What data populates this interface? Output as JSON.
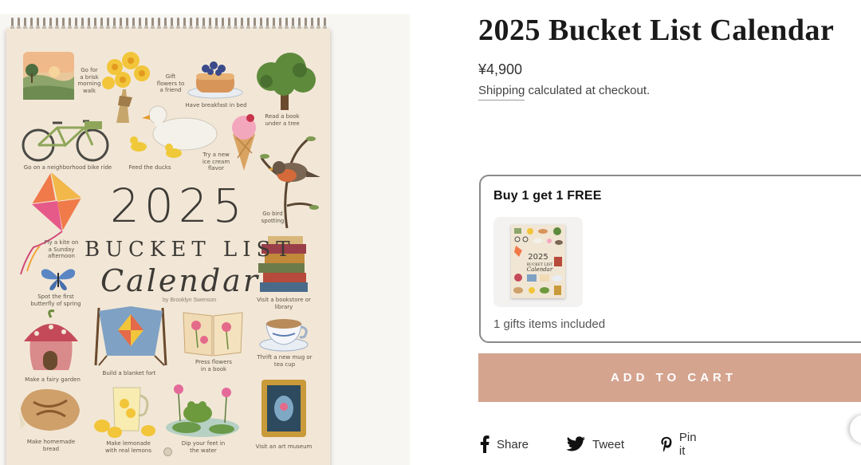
{
  "product": {
    "title": "2025 Bucket List Calendar",
    "price": "¥4,900",
    "shipping_link": "Shipping",
    "shipping_rest": " calculated at checkout."
  },
  "calendar_cover": {
    "year": "2025",
    "title_line1": "BUCKET LIST",
    "title_line2": "Calendar",
    "byline": "by Brooklyn Swenson",
    "captions": {
      "walk": "Go for\na brisk\nmorning\nwalk",
      "gift": "Gift\nflowers to\na friend",
      "breakfast": "Have breakfast in bed",
      "read": "Read a book\nunder a tree",
      "bike": "Go on a neighborhood bike ride",
      "ducks": "Feed the ducks",
      "icecream": "Try a new\nice cream\nflavor",
      "bird": "Go bird\nspotting",
      "kite": "Fly a kite on\na Sunday\nafternoon",
      "butterfly": "Spot the first\nbutterfly of spring",
      "bookstore": "Visit a bookstore or\nlibrary",
      "fairy": "Make a fairy garden",
      "fort": "Build a blanket fort",
      "press": "Press flowers\nin a book",
      "mug": "Thrift a new mug or\ntea cup",
      "bread": "Make homemade\nbread",
      "lemonade": "Make lemonade\nwith real lemons",
      "feet": "Dip your feet in\nthe water",
      "museum": "Visit an art museum"
    }
  },
  "offer": {
    "title": "Buy 1 get 1 FREE",
    "footer": "1 gifts items included",
    "mini_year": "2025",
    "mini_title1": "BUCKET LIST",
    "mini_title2": "Calendar"
  },
  "actions": {
    "add_to_cart": "ADD TO CART"
  },
  "share": {
    "facebook": "Share",
    "twitter": "Tweet",
    "pinterest": "Pin it"
  },
  "colors": {
    "cart_button": "#d5a48f",
    "calendar_paper": "#f2e7d6",
    "offer_border": "#8a8a8a"
  },
  "icons": [
    "facebook-icon",
    "twitter-icon",
    "pinterest-icon"
  ]
}
